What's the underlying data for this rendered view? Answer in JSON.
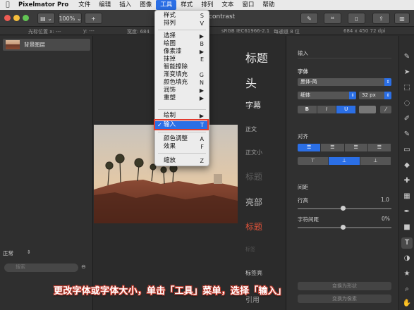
{
  "menubar": {
    "apple": "",
    "app": "Pixelmator Pro",
    "items": [
      "文件",
      "编辑",
      "插入",
      "图像",
      "工具",
      "样式",
      "排列",
      "文本",
      "窗口",
      "帮助"
    ],
    "active_index": 4
  },
  "toolbar": {
    "zoom": "100%",
    "add": "+",
    "doc_title": "ercontrast"
  },
  "infobar": {
    "cursor": "光标位置 x: ---",
    "cursor_y": "y: ---",
    "width": "宽度: 684",
    "colorspace": "sRGB IEC61966-2.1",
    "depth": "每通道 8 位",
    "size": "684 x 450 72 dpi"
  },
  "layers": {
    "background_layer": "背景图层",
    "blend_mode": "正常",
    "search_placeholder": "搜索"
  },
  "tools_menu": {
    "items": [
      {
        "label": "样式",
        "shortcut": "S"
      },
      {
        "label": "排列",
        "shortcut": "V"
      },
      {
        "label": "选择",
        "shortcut": "▶"
      },
      {
        "label": "绘图",
        "shortcut": "B"
      },
      {
        "label": "像素漆",
        "shortcut": "▶"
      },
      {
        "label": "抹掉",
        "shortcut": "E"
      },
      {
        "label": "智能擦除",
        "shortcut": ""
      },
      {
        "label": "渐变填充",
        "shortcut": "G"
      },
      {
        "label": "颜色填充",
        "shortcut": "N"
      },
      {
        "label": "润饰",
        "shortcut": "▶"
      },
      {
        "label": "重塑",
        "shortcut": "▶"
      },
      {
        "label": "绘制",
        "shortcut": "▶"
      },
      {
        "label": "输入",
        "shortcut": "T"
      },
      {
        "label": "颜色调整",
        "shortcut": "A"
      },
      {
        "label": "效果",
        "shortcut": "F"
      },
      {
        "label": "缩放",
        "shortcut": "Z"
      }
    ],
    "selected_label": "输入"
  },
  "styles": [
    "标题",
    "头",
    "字幕",
    "正文",
    "正文小",
    "标题",
    "亮部",
    "标题",
    "标签",
    "标签亮",
    "引用"
  ],
  "inspector": {
    "section_input": "输入",
    "font_label": "字体",
    "font_name": "黑体-简",
    "font_weight": "细体",
    "font_size": "32 px",
    "bold": "B",
    "italic": "I",
    "underline": "U",
    "align_label": "对齐",
    "spacing_label": "间距",
    "line_height_label": "行高",
    "line_height_value": "1.0",
    "char_spacing_label": "字符间距",
    "char_spacing_value": "0%",
    "convert_shape": "变换为形状",
    "convert_pixels": "变换为像素"
  },
  "caption": "更改字体或字体大小，单击「工具」菜单，选择「输入」",
  "colors": {
    "accent": "#2b6fe6",
    "highlight": "#e23c2f",
    "style_red": "#e0533a"
  }
}
